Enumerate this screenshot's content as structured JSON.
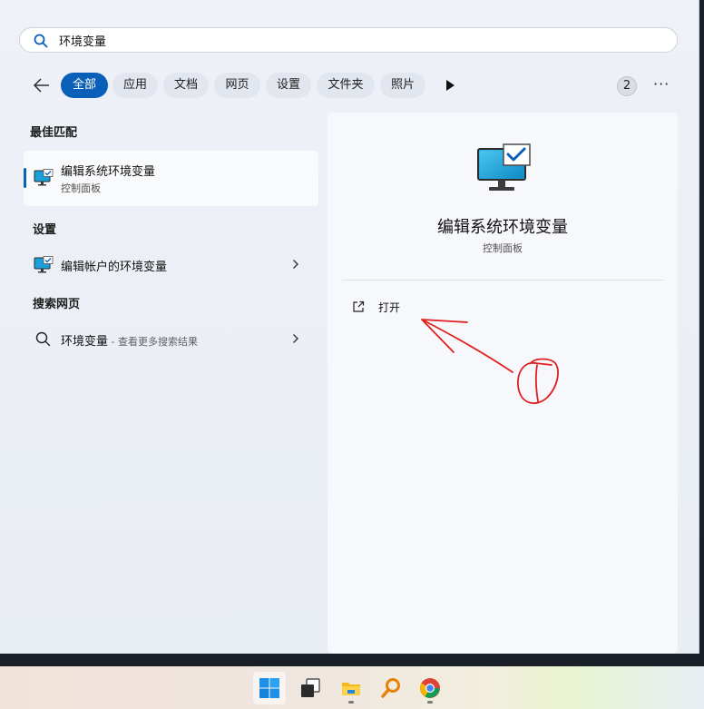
{
  "search": {
    "value": "环境变量"
  },
  "filters": [
    "全部",
    "应用",
    "文档",
    "网页",
    "设置",
    "文件夹",
    "照片"
  ],
  "badge_count": "2",
  "best_match": {
    "heading": "最佳匹配",
    "title": "编辑系统环境变量",
    "subtitle": "控制面板"
  },
  "settings": {
    "heading": "设置",
    "item_label": "编辑帐户的环境变量"
  },
  "web": {
    "heading": "搜索网页",
    "item_label": "环境变量",
    "item_suffix": " - 查看更多搜索结果"
  },
  "detail": {
    "title": "编辑系统环境变量",
    "subtitle": "控制面板",
    "open_label": "打开"
  },
  "annotation": {
    "color": "#e02020"
  },
  "accent_color": "#0a5fb8",
  "taskbar": {
    "apps": [
      "windows-start-icon",
      "task-view-icon",
      "file-explorer-icon",
      "search-app-icon",
      "chrome-icon"
    ]
  }
}
